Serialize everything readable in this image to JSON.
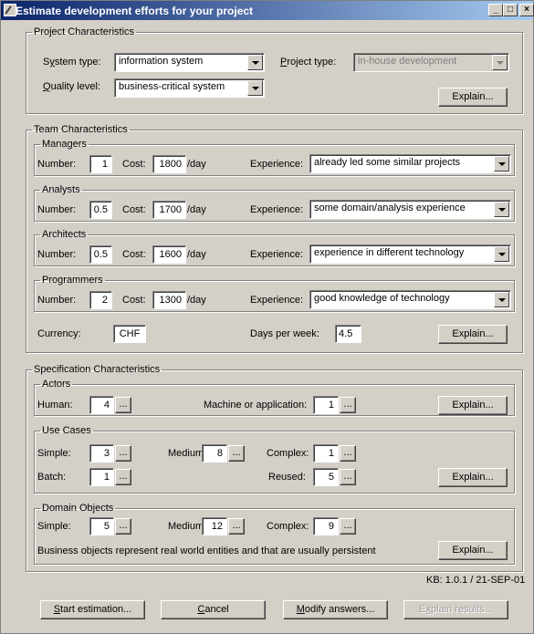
{
  "window": {
    "title": "Estimate development efforts for your project",
    "minimize": "_",
    "maximize": "□",
    "close": "×"
  },
  "project": {
    "legend": "Project Characteristics",
    "system_type_label": "System type:",
    "system_type_label_mnemonic": "y",
    "system_type_value": "information system",
    "project_type_label": "Project type:",
    "project_type_value": "in-house development",
    "quality_label": "Quality level:",
    "quality_value": "business-critical system",
    "explain": "Explain..."
  },
  "team": {
    "legend": "Team Characteristics",
    "number_label": "Number:",
    "cost_label": "Cost:",
    "per_day": "/day",
    "experience_label": "Experience:",
    "groups": [
      {
        "legend": "Managers",
        "number": "1",
        "cost": "1800",
        "experience": "already led some similar projects"
      },
      {
        "legend": "Analysts",
        "number": "0.5",
        "cost": "1700",
        "experience": "some domain/analysis experience"
      },
      {
        "legend": "Architects",
        "number": "0.5",
        "cost": "1600",
        "experience": "experience in different technology"
      },
      {
        "legend": "Programmers",
        "number": "2",
        "cost": "1300",
        "experience": "good knowledge of technology"
      }
    ],
    "currency_label": "Currency:",
    "currency_value": "CHF",
    "days_label": "Days per week:",
    "days_value": "4.5",
    "explain": "Explain..."
  },
  "spec": {
    "legend": "Specification Characteristics",
    "actors": {
      "legend": "Actors",
      "human_label": "Human:",
      "human_value": "4",
      "machine_label": "Machine or application:",
      "machine_value": "1",
      "explain": "Explain..."
    },
    "use_cases": {
      "legend": "Use Cases",
      "simple_label": "Simple:",
      "simple_value": "3",
      "medium_label": "Medium:",
      "medium_value": "8",
      "complex_label": "Complex:",
      "complex_value": "1",
      "batch_label": "Batch:",
      "batch_value": "1",
      "reused_label": "Reused:",
      "reused_value": "5",
      "explain": "Explain..."
    },
    "domain": {
      "legend": "Domain Objects",
      "simple_label": "Simple:",
      "simple_value": "5",
      "medium_label": "Medium:",
      "medium_value": "12",
      "complex_label": "Complex:",
      "complex_value": "9",
      "note": "Business objects represent real world entities and that are usually persistent",
      "explain": "Explain..."
    },
    "dots": "..."
  },
  "kb": "KB: 1.0.1 / 21-SEP-01",
  "buttons": {
    "start": "Start estimation...",
    "cancel": "Cancel",
    "modify": "Modify answers...",
    "explain_results": "Explain results..."
  }
}
